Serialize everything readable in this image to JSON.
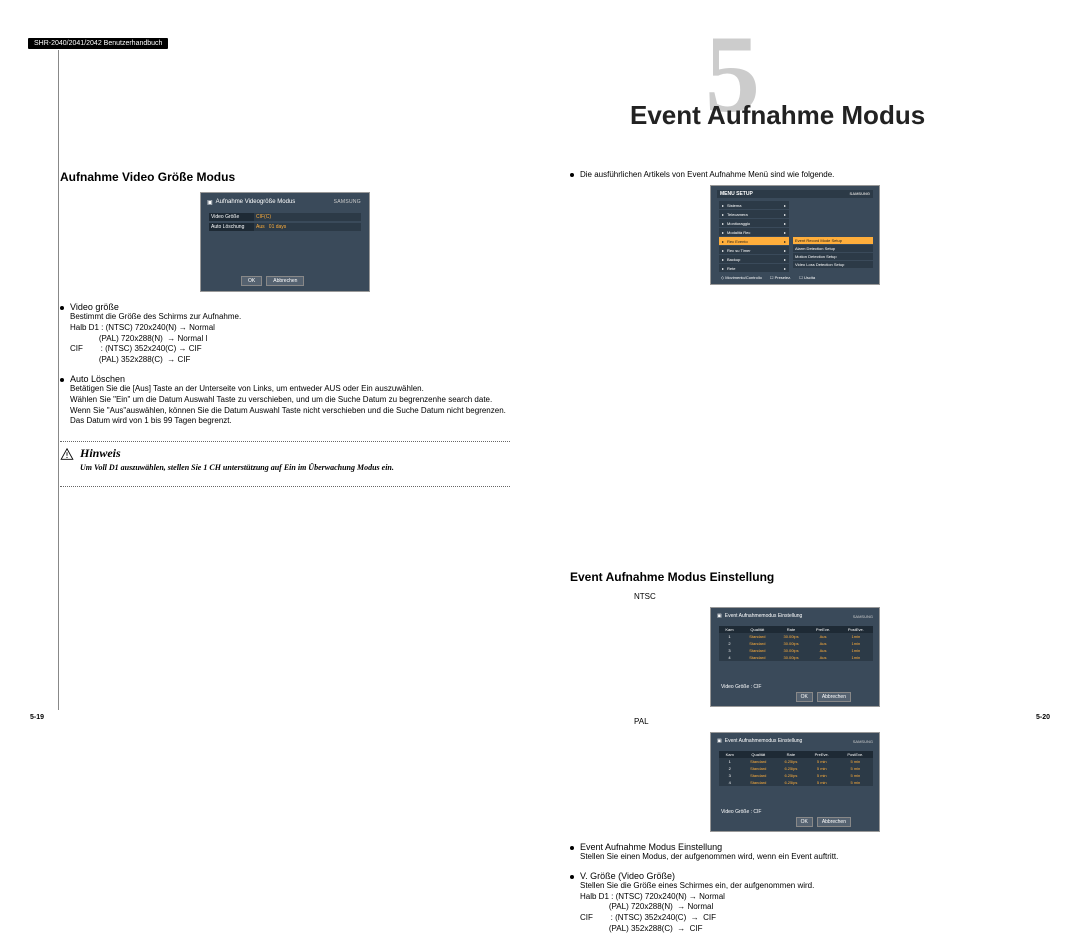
{
  "manual_header": "SHR-2040/2041/2042 Benutzerhandbuch",
  "chapter_number": "5",
  "chapter_title": "Event Aufnahme Modus",
  "left": {
    "section_title": "Aufnahme Video Größe Modus",
    "shotA": {
      "title": "Aufnahme Videogröße Modus",
      "brand": "SAMSUNG",
      "rows": [
        {
          "label": "Video Größe",
          "value": "CIF(C)"
        },
        {
          "label": "Auto Löschung",
          "value": "Aus",
          "value2": "01 days"
        }
      ],
      "ok": "OK",
      "cancel": "Abbrechen"
    },
    "bullets": [
      {
        "title": "Video größe",
        "lines": [
          "Bestimmt die Größe des Schirms zur Aufnahme.",
          "Halb D1 : (NTSC) 720x240(N) → Normal",
          "             (PAL) 720x288(N)  → Normal l",
          "CIF        : (NTSC) 352x240(C) → CIF",
          "             (PAL) 352x288(C)  → CIF"
        ]
      },
      {
        "title": "Auto Löschen",
        "lines": [
          "Betätigen Sie die [Aus] Taste an der Unterseite von Links, um entweder AUS oder Ein auszuwählen.",
          "Wählen Sie \"Ein\" um die Datum Auswahl Taste zu verschieben, und um die Suche Datum zu begrenzenhe search date.",
          "Wenn Sie \"Aus\"auswählen, können Sie die Datum Auswahl Taste nicht verschieben und die Suche Datum nicht begrenzen.",
          "Das Datum wird von 1 bis 99 Tagen begrenzt."
        ]
      }
    ],
    "hinweis_title": "Hinweis",
    "hinweis_body": "Um Voll D1 auszuwählen, stellen Sie 1 CH unterstützung auf Ein im Überwachung Modus ein."
  },
  "right": {
    "intro": "Die ausführlichen Artikels von Event Aufnahme Menü sind wie folgende.",
    "shotB": {
      "top": "MENU SETUP",
      "brand": "SAMSUNG",
      "items": [
        "Sistema",
        "Telecamera",
        "Monitoraggio",
        "Modalità Rec",
        "Rec Evento",
        "Rec su Timer",
        "Backup",
        "Rete"
      ],
      "selected_index": 4,
      "subs": [
        "Event Record Mode Setup",
        "Alarm Detection Setup",
        "Motion Detection Setup",
        "Video Loss Detection Setup"
      ],
      "sub_selected_index": 0,
      "foot": [
        "Movimento/Controllo",
        "Preselez.",
        "Uscita"
      ]
    },
    "section_title": "Event Aufnahme Modus Einstellung",
    "label_ntsc": "NTSC",
    "label_pal": "PAL",
    "shotC_title": "Event Aufnahmemodus Einstellung",
    "shotC_brand": "SAMSUNG",
    "table_head": [
      "Kam",
      "Qualität",
      "Rate",
      "PreEve.",
      "PostEve."
    ],
    "ntsc_rows": [
      [
        "1",
        "Standard",
        "30.00ips",
        "Aus",
        "1min"
      ],
      [
        "2",
        "Standard",
        "30.00ips",
        "Aus",
        "1min"
      ],
      [
        "3",
        "Standard",
        "30.00ips",
        "Aus",
        "1min"
      ],
      [
        "4",
        "Standard",
        "30.00ips",
        "Aus",
        "1min"
      ]
    ],
    "pal_rows": [
      [
        "1",
        "Standard",
        "6.25ips",
        "5 min",
        "5 min"
      ],
      [
        "2",
        "Standard",
        "6.25ips",
        "5 min",
        "5 min"
      ],
      [
        "3",
        "Standard",
        "6.25ips",
        "5 min",
        "5 min"
      ],
      [
        "4",
        "Standard",
        "6.25ips",
        "5 min",
        "5 min"
      ]
    ],
    "vg_label": "Video Größe : CIF",
    "ok": "OK",
    "cancel": "Abbrechen",
    "bullets": [
      {
        "title": "Event Aufnahme Modus Einstellung",
        "lines": [
          "Stellen Sie einen Modus, der aufgenommen wird, wenn ein Event auftritt."
        ]
      },
      {
        "title": "V. Größe (Video Größe)",
        "lines": [
          "Stellen Sie die Größe eines Schirmes ein, der aufgenommen wird.",
          "Halb D1 : (NTSC) 720x240(N) → Normal",
          "             (PAL) 720x288(N)  → Normal",
          "CIF        : (NTSC) 352x240(C)  →  CIF",
          "             (PAL) 352x288(C)  →  CIF"
        ]
      }
    ]
  },
  "page_left": "5-19",
  "page_right": "5-20"
}
